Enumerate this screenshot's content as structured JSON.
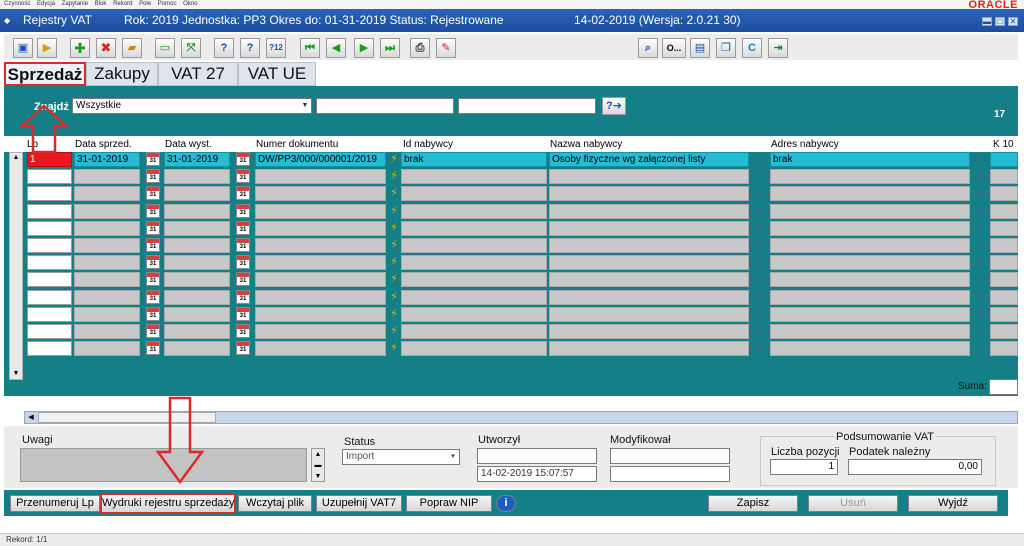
{
  "menu": [
    "Czynność",
    "Edycja",
    "Zapytanie",
    "Blok",
    "Rekord",
    "Pole",
    "Pomoc",
    "Okno"
  ],
  "brand": "ORACLE",
  "window": {
    "title": "Rejestry VAT",
    "context": "Rok: 2019 Jednostka: PP3 Okres do: 01-31-2019 Status: Rejestrowane",
    "date_version": "14-02-2019  (Wersja: 2.0.21 30)",
    "minimize": "▬",
    "close": "✕"
  },
  "toolbar_icons": [
    "save-icon",
    "open-folder-icon",
    "add-record-icon",
    "delete-record-icon",
    "clear-record-icon",
    "duplicate-record-icon",
    "expand-icon",
    "query-icon",
    "execute-query-icon",
    "count-query-icon",
    "first-record-icon",
    "previous-record-icon",
    "next-record-icon",
    "last-record-icon",
    "print-icon",
    "edit-icon",
    "preview-icon",
    "options-icon",
    "notebook-icon",
    "window-icon",
    "calculator-icon",
    "exit-icon"
  ],
  "toolbar_glyphs": {
    "o_label": "O...",
    "count": "12"
  },
  "tabs": [
    "Sprzedaż",
    "Zakupy",
    "VAT 27",
    "VAT UE"
  ],
  "find": {
    "label": "Znajdź",
    "selected": "Wszystkie",
    "input1": "",
    "input2": "",
    "count": "17"
  },
  "columns": [
    "Lp",
    "Data sprzed.",
    "Data wyst.",
    "Numer dokumentu",
    "Id nabywcy",
    "Nazwa nabywcy",
    "Adres nabywcy",
    "K 10"
  ],
  "row1": {
    "lp": "1",
    "data_sprzed": "31-01-2019",
    "data_wyst": "31-01-2019",
    "numer": "DW/PP3/000/000001/2019",
    "id_nabywcy": "brak",
    "nazwa": "Osoby fizyczne wg załączonej listy",
    "adres": "brak"
  },
  "cal_glyph": "31",
  "bolt_glyph": "⚡",
  "dd_glyph": "▼",
  "suma_label": "Suma:",
  "details": {
    "uwagi_label": "Uwagi",
    "status_label": "Status",
    "status_value": "Import",
    "utworzyl_label": "Utworzył",
    "utworzyl_value": "",
    "utworzyl_date": "14-02-2019 15:07:57",
    "modyfikowal_label": "Modyfikował",
    "modyfikowal_value": "",
    "modyfikowal_date": "",
    "summary_title": "Podsumowanie VAT",
    "liczba_label": "Liczba pozycji",
    "liczba_value": "1",
    "podatek_label": "Podatek należny",
    "podatek_value": "0,00"
  },
  "buttons": {
    "przenumeruj": "Przenumeruj Lp",
    "wydruki": "Wydruki rejestru sprzedaży",
    "wczytaj": "Wczytaj plik",
    "uzupelnij": "Uzupełnij VAT7",
    "popraw": "Popraw NIP",
    "info": "i",
    "zapisz": "Zapisz",
    "usun": "Usuń",
    "wyjdz": "Wyjdź"
  },
  "status_bar": "Rekord: 1/1",
  "colors": {
    "teal": "#157f87",
    "title_blue": "#1c4e9e",
    "annotation_red": "#d92b2b",
    "selected_row": "#26bdd4"
  }
}
